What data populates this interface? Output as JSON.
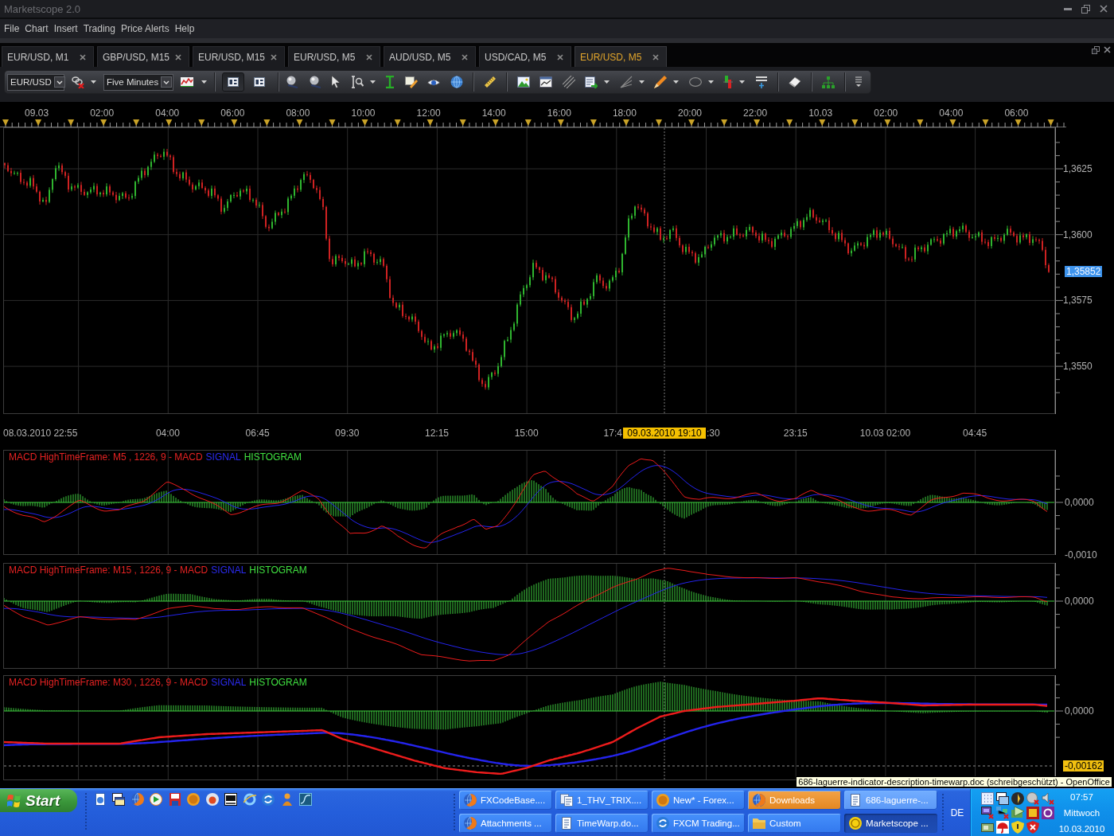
{
  "window": {
    "title": "Marketscope 2.0"
  },
  "menu": [
    "File",
    "Chart",
    "Insert",
    "Trading",
    "Price Alerts",
    "Help"
  ],
  "tabs": [
    {
      "label": "EUR/USD, M1",
      "selected": false
    },
    {
      "label": "GBP/USD, M15",
      "selected": false
    },
    {
      "label": "EUR/USD, M15",
      "selected": false
    },
    {
      "label": "EUR/USD, M5",
      "selected": false
    },
    {
      "label": "AUD/USD, M5",
      "selected": false
    },
    {
      "label": "USD/CAD, M5",
      "selected": false
    },
    {
      "label": "EUR/USD, M5",
      "selected": true
    }
  ],
  "toolbar": {
    "instrument": "EUR/USD",
    "timeframe": "Five Minutes",
    "layout_toggles": [
      {
        "selected": true
      },
      {
        "selected": false
      }
    ]
  },
  "price_chart": {
    "time_labels": [
      "09.03",
      "02:00",
      "04:00",
      "06:00",
      "08:00",
      "10:00",
      "12:00",
      "14:00",
      "16:00",
      "18:00",
      "20:00",
      "22:00",
      "10.03",
      "02:00",
      "04:00",
      "06:00"
    ],
    "price_labels": [
      "1,3625",
      "1,3600",
      "1,3575",
      "1,3550"
    ],
    "current_price": "1,35852",
    "date_labels": [
      "08.03.2010 22:55",
      "04:00",
      "06:45",
      "09:30",
      "12:15",
      "15:00",
      "17:4",
      ":30",
      "23:15",
      "10.03 02:00",
      "04:45"
    ],
    "cursor_time": "09.03.2010 19:10"
  },
  "indicators": [
    {
      "title": "MACD HighTimeFrame: M5 , 1226, 9 - MACD",
      "signal_label": "SIGNAL",
      "histogram_label": "HISTOGRAM",
      "axis_labels": [
        "0,0000",
        "-0,0010"
      ]
    },
    {
      "title": "MACD HighTimeFrame: M15 , 1226, 9 - MACD",
      "signal_label": "SIGNAL",
      "histogram_label": "HISTOGRAM",
      "axis_labels": [
        "0,0000"
      ]
    },
    {
      "title": "MACD HighTimeFrame: M30 , 1226, 9 - MACD",
      "signal_label": "SIGNAL",
      "histogram_label": "HISTOGRAM",
      "axis_labels": [
        "0,0000"
      ],
      "cursor_value": "-0,00162"
    }
  ],
  "tooltip": "686-laguerre-indicator-description-timewarp.doc (schreibgeschützt) - OpenOffice",
  "taskbar": {
    "start": "Start",
    "tasks": [
      {
        "label": "FXCodeBase....",
        "kind": "browser",
        "selected": false,
        "flashing": false,
        "hovered": false
      },
      {
        "label": "1_THV_TRIX....",
        "kind": "documents",
        "selected": false,
        "flashing": false,
        "hovered": false
      },
      {
        "label": "New* - Forex...",
        "kind": "chat",
        "selected": false,
        "flashing": false,
        "hovered": false
      },
      {
        "label": "Downloads",
        "kind": "browser",
        "selected": false,
        "flashing": true,
        "hovered": false
      },
      {
        "label": "686-laguerre-...",
        "kind": "document",
        "selected": false,
        "flashing": false,
        "hovered": true
      },
      {
        "label": "Attachments ...",
        "kind": "browser",
        "selected": false,
        "flashing": false,
        "hovered": false
      },
      {
        "label": "TimeWarp.do...",
        "kind": "document",
        "selected": false,
        "flashing": false,
        "hovered": false
      },
      {
        "label": "FXCM Trading...",
        "kind": "sync",
        "selected": false,
        "flashing": false,
        "hovered": false
      },
      {
        "label": "Custom",
        "kind": "folder",
        "selected": false,
        "flashing": false,
        "hovered": false
      },
      {
        "label": "Marketscope ...",
        "kind": "trading",
        "selected": true,
        "flashing": false,
        "hovered": false
      }
    ],
    "language": "DE",
    "clock": {
      "time": "07:57",
      "day": "Mittwoch",
      "date": "10.03.2010"
    }
  }
}
